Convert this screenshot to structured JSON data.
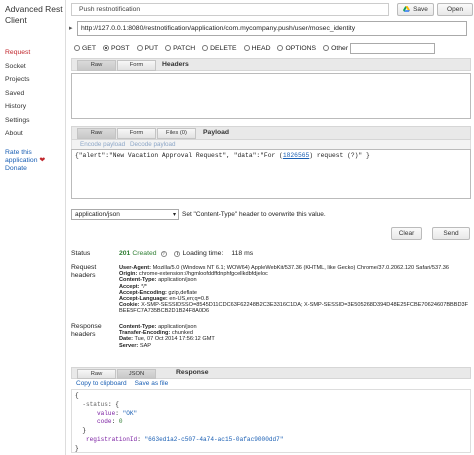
{
  "app": {
    "title": "Advanced Rest Client"
  },
  "sidebar": {
    "items": [
      {
        "label": "Request",
        "active": true
      },
      {
        "label": "Socket"
      },
      {
        "label": "Projects"
      },
      {
        "label": "Saved"
      },
      {
        "label": "History"
      },
      {
        "label": "Settings"
      },
      {
        "label": "About"
      }
    ],
    "rate_label": "Rate this application",
    "rate_icon": "heart-icon",
    "donate_label": "Donate"
  },
  "toolbar": {
    "title_value": "Push restnotification",
    "save_label": "Save",
    "open_label": "Open"
  },
  "request": {
    "url": "http://127.0.0.1:8080/restnotification/application/com.mycompany.push/user/mosec_identity",
    "methods": [
      "GET",
      "POST",
      "PUT",
      "PATCH",
      "DELETE",
      "HEAD",
      "OPTIONS",
      "Other"
    ],
    "selected_method": "POST"
  },
  "headers_tabs": {
    "raw": "Raw",
    "form": "Form",
    "heading": "Headers"
  },
  "payload_tabs": {
    "raw": "Raw",
    "form": "Form",
    "files": "Files (0)",
    "heading": "Payload"
  },
  "payload": {
    "encode": "Encode payload",
    "decode": "Decode payload",
    "body_prefix": "{\"alert\":\"New Vacation Approval Request\", \"data\":\"For (",
    "body_link": "1826565",
    "body_suffix": ") request (?)\" }"
  },
  "content_type": {
    "selected": "application/json",
    "hint": "Set \"Content-Type\" header to overwrite this value."
  },
  "actions": {
    "clear": "Clear",
    "send": "Send"
  },
  "response": {
    "status_label": "Status",
    "status_code": "201",
    "status_text": "Created",
    "status_icon": "help-icon",
    "loading_label": "Loading time:",
    "loading_value": "118 ms",
    "request_headers_label": "Request headers",
    "request_headers": [
      {
        "k": "User-Agent:",
        "v": "Mozilla/5.0 (Windows NT 6.1; WOW64) AppleWebKit/537.36 (KHTML, like Gecko) Chrome/37.0.2062.120 Safari/537.36"
      },
      {
        "k": "Origin:",
        "v": "chrome-extension://hgmloofddffdnphfgcellkdbfdjeloc"
      },
      {
        "k": "Content-Type:",
        "v": "application/json"
      },
      {
        "k": "Accept:",
        "v": "*/*"
      },
      {
        "k": "Accept-Encoding:",
        "v": "gzip,deflate"
      },
      {
        "k": "Accept-Language:",
        "v": "en-US,en;q=0.8"
      },
      {
        "k": "Cookie:",
        "v": "X-SMP-SESSIDSSO=8545D11CDC63F62248B2C3E3316C1DA; X-SMP-SESSID=3E505268D394D48E25FCBE70624607BBBD3FBEE5FC7A735BCB2D1B24F8A0D6"
      }
    ],
    "response_headers_label": "Response headers",
    "response_headers": [
      {
        "k": "Content-Type:",
        "v": "application/json"
      },
      {
        "k": "Transfer-Encoding:",
        "v": "chunked"
      },
      {
        "k": "Date:",
        "v": "Tue, 07 Oct 2014 17:56:12 GMT"
      },
      {
        "k": "Server:",
        "v": "SAP"
      }
    ]
  },
  "response_tabs": {
    "raw": "Raw",
    "json": "JSON",
    "heading": "Response"
  },
  "response_links": {
    "copy": "Copy to clipboard",
    "save": "Save as file"
  },
  "response_json": {
    "line1": "{",
    "status_key": "-status",
    "status_open": ": {",
    "value_key": "value",
    "value_val": "\"OK\"",
    "code_key": "code",
    "code_val": "0",
    "status_close": "}",
    "reg_key": "registrationId",
    "reg_val": "\"663ed1a2-c507-4a74-ac15-0afac9000dd7\"",
    "end": "}"
  },
  "colors": {
    "active_nav": "#c1272d",
    "link": "#1a5fb4",
    "status_ok": "#2e7d32"
  }
}
